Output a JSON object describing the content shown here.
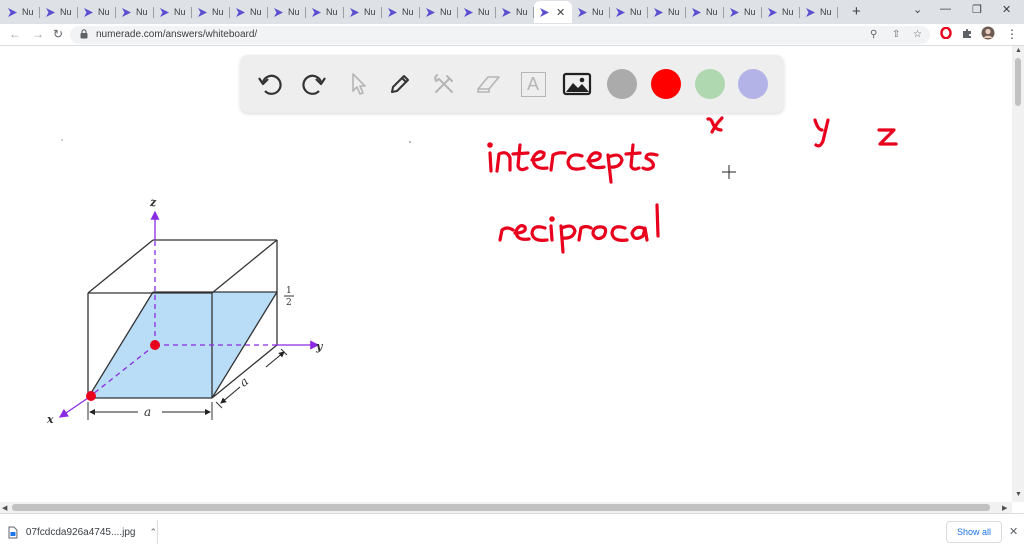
{
  "browser": {
    "tab_title": "Nu",
    "tab_count": 22,
    "active_tab_index": 14,
    "new_tab_label": "+",
    "address": {
      "url": "numerade.com/answers/whiteboard/"
    },
    "icons": [
      "back-icon",
      "forward-icon",
      "reload-icon",
      "lock-icon",
      "zoom-icon",
      "share-icon",
      "star-icon",
      "opera-icon",
      "extensions-icon",
      "profile-avatar",
      "menu-icon"
    ]
  },
  "whiteboard": {
    "tools": [
      "undo-icon",
      "redo-icon",
      "select-icon",
      "pen-icon",
      "tools-icon",
      "eraser-icon",
      "text-icon",
      "image-icon"
    ],
    "text_tool_label": "A",
    "colors": [
      {
        "name": "gray",
        "hex": "#ababab"
      },
      {
        "name": "red",
        "hex": "#ff0000"
      },
      {
        "name": "green",
        "hex": "#b0d8b0"
      },
      {
        "name": "purple",
        "hex": "#b3b3e8"
      }
    ],
    "handwriting": [
      "intercepts",
      "reciprocal",
      "x",
      "y",
      "z"
    ]
  },
  "figure": {
    "axis_labels": {
      "x": "x",
      "y": "y",
      "z": "z"
    },
    "dimension_labels": {
      "bottom": "a",
      "side": "a"
    },
    "fraction": {
      "numerator": "1",
      "denominator": "2"
    },
    "plane_color": "#b9dcf7"
  },
  "downloads": {
    "file_name": "07fcdcda926a4745....jpg",
    "show_all_label": "Show all"
  }
}
